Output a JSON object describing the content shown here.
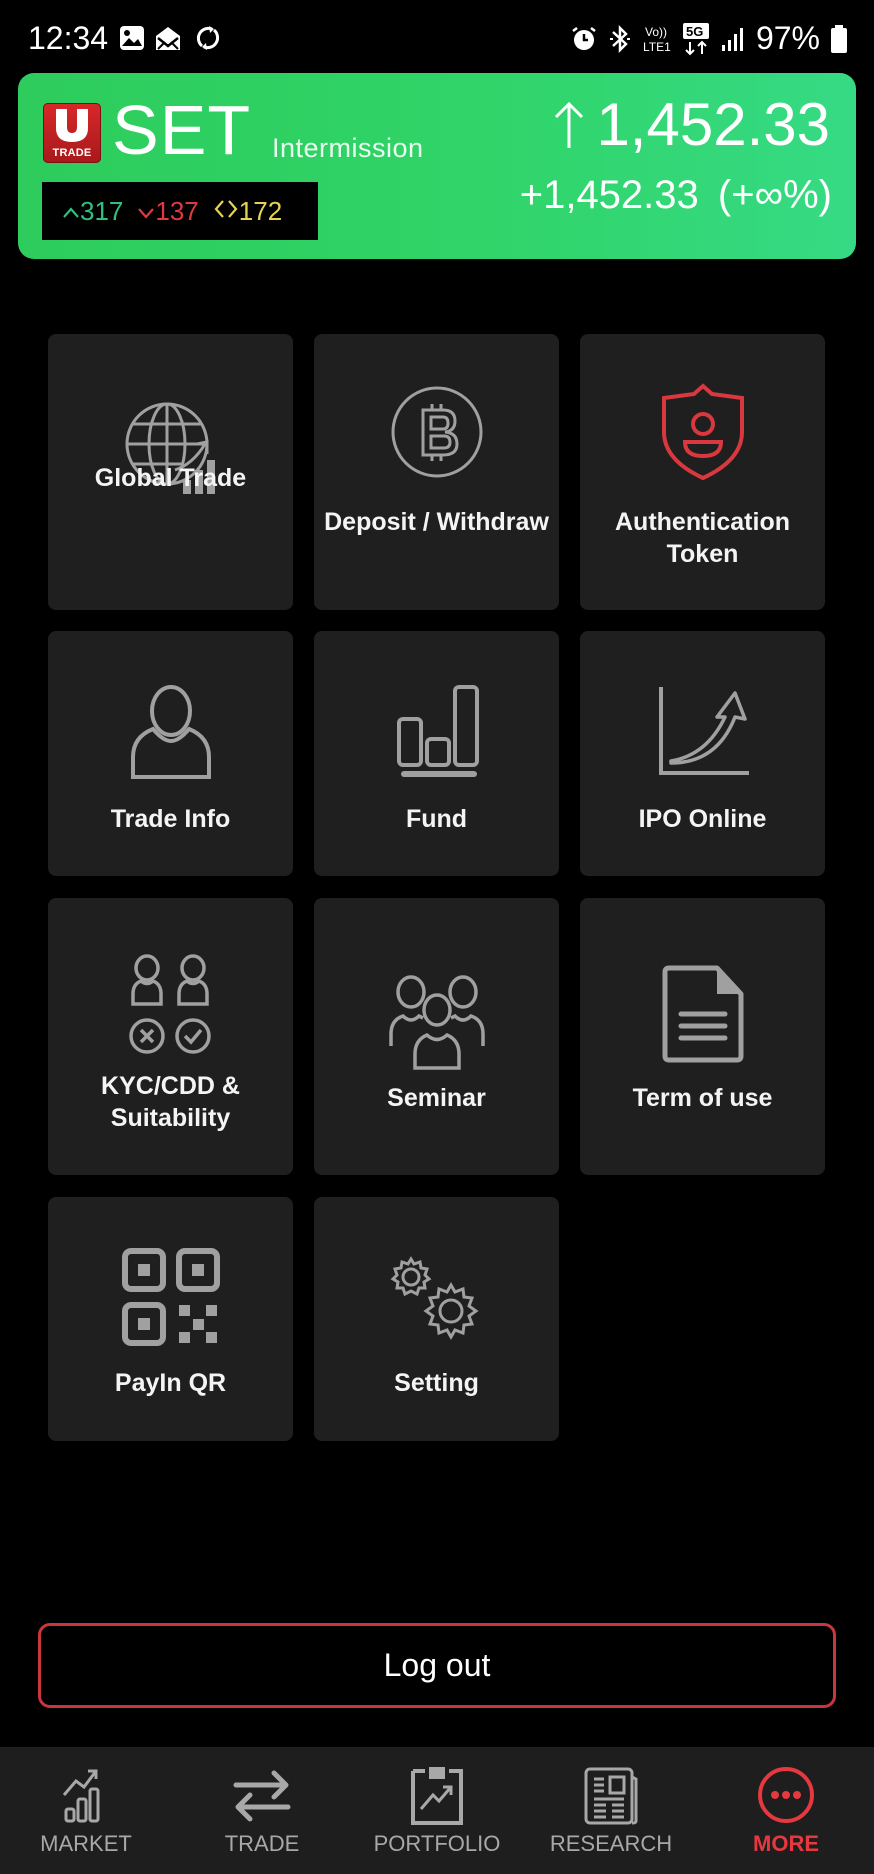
{
  "status_bar": {
    "time": "12:34",
    "left_icons": [
      "gallery-icon",
      "mail-icon",
      "sync-icon"
    ],
    "right_icons": [
      "alarm-icon",
      "bluetooth-icon",
      "volte-icon",
      "5g-icon",
      "signal-icon"
    ],
    "battery": "97%"
  },
  "market": {
    "logo_text": "TRADE",
    "logo_letter": "U",
    "index_name": "SET",
    "session": "Intermission",
    "advances": "317",
    "declines": "137",
    "unchanged": "172",
    "price": "1,452.33",
    "direction": "up",
    "change": "+1,452.33",
    "change_pct": "(+∞%)",
    "colors": {
      "up": "#2ec27e",
      "down": "#e0393f",
      "unchanged": "#e5d352",
      "card": "#30d468"
    }
  },
  "menu": {
    "tiles": [
      {
        "label": "Global Trade",
        "icon": "globe-chart-icon"
      },
      {
        "label": "Deposit / Withdraw",
        "icon": "bitcoin-coin-icon"
      },
      {
        "label": "Authentication Token",
        "icon": "shield-user-icon"
      },
      {
        "label": "Trade Info",
        "icon": "user-icon"
      },
      {
        "label": "Fund",
        "icon": "bar-chart-icon"
      },
      {
        "label": "IPO Online",
        "icon": "growth-arrow-icon"
      },
      {
        "label": "KYC/CDD & Suitability",
        "icon": "kyc-users-icon"
      },
      {
        "label": "Seminar",
        "icon": "group-icon"
      },
      {
        "label": "Term of use",
        "icon": "document-icon"
      },
      {
        "label": "PayIn QR",
        "icon": "qr-code-icon"
      },
      {
        "label": "Setting",
        "icon": "gears-icon"
      }
    ]
  },
  "logout_label": "Log out",
  "nav": {
    "items": [
      {
        "label": "MARKET",
        "icon": "market-chart-icon",
        "active": false
      },
      {
        "label": "TRADE",
        "icon": "swap-arrows-icon",
        "active": false
      },
      {
        "label": "PORTFOLIO",
        "icon": "portfolio-icon",
        "active": false
      },
      {
        "label": "RESEARCH",
        "icon": "newspaper-icon",
        "active": false
      },
      {
        "label": "MORE",
        "icon": "more-dots-icon",
        "active": true
      }
    ],
    "active_color": "#e5383f"
  }
}
